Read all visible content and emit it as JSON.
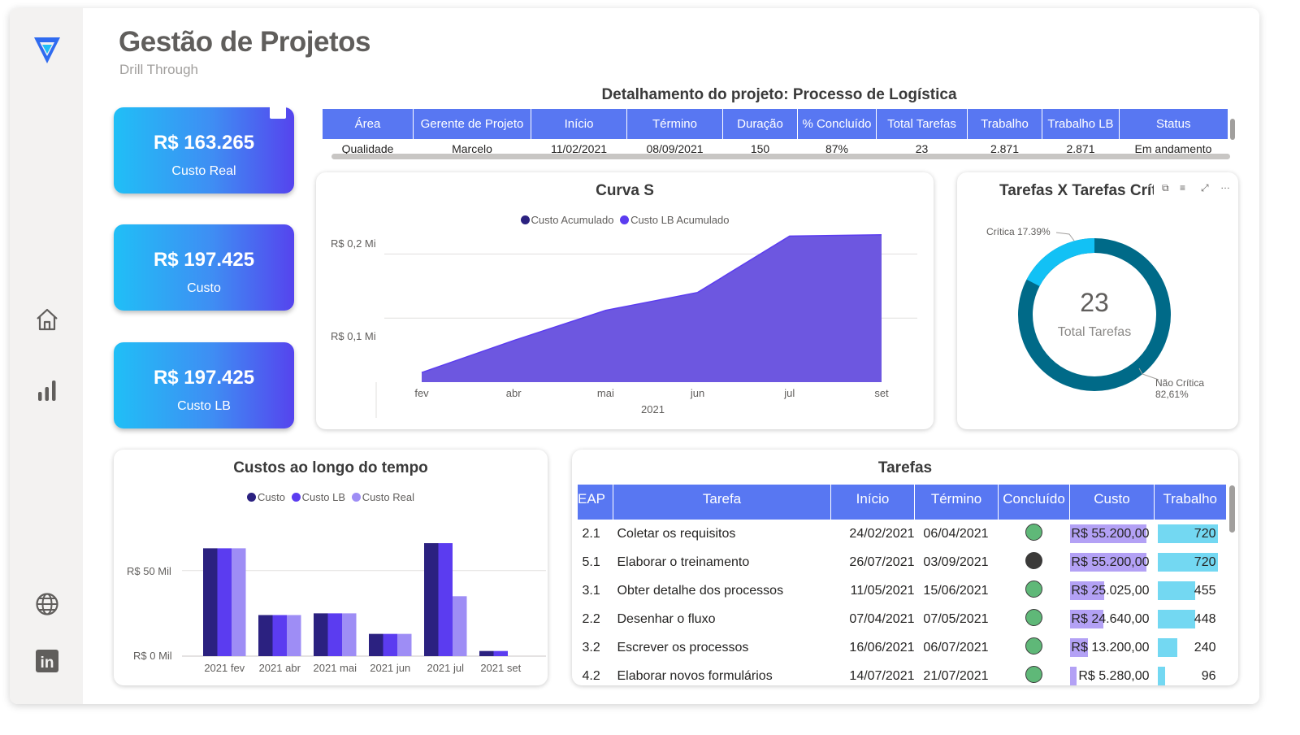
{
  "page": {
    "title": "Gestão de Projetos",
    "subtitle": "Drill Through"
  },
  "sidebar": {
    "items": [
      {
        "icon": "logo-icon"
      },
      {
        "icon": "home-icon"
      },
      {
        "icon": "bar-chart-icon"
      },
      {
        "icon": "globe-icon"
      },
      {
        "icon": "linkedin-icon",
        "text": "in"
      }
    ]
  },
  "kpis": [
    {
      "value": "R$ 163.265",
      "label": "Custo Real"
    },
    {
      "value": "R$ 197.425",
      "label": "Custo"
    },
    {
      "value": "R$ 197.425",
      "label": "Custo LB"
    }
  ],
  "detail": {
    "title": "Detalhamento do projeto: Processo de Logística",
    "columns": [
      "Área",
      "Gerente de Projeto",
      "Início",
      "Término",
      "Duração",
      "% Concluído",
      "Total Tarefas",
      "Trabalho",
      "Trabalho LB",
      "Status"
    ],
    "row": [
      "Qualidade",
      "Marcelo",
      "11/02/2021",
      "08/09/2021",
      "150",
      "87%",
      "23",
      "2.871",
      "2.871",
      "Em andamento"
    ]
  },
  "curva_s": {
    "title": "Curva S",
    "legend": [
      {
        "name": "Custo Acumulado",
        "color": "#2b2180"
      },
      {
        "name": "Custo LB Acumulado",
        "color": "#5b3cf0"
      }
    ],
    "y_ticks": [
      "R$ 0,2 Mi",
      "R$ 0,1 Mi"
    ],
    "x_ticks": [
      "fev",
      "abr",
      "mai",
      "jun",
      "jul",
      "set"
    ],
    "x_title": "2021"
  },
  "donut": {
    "title": "Tarefas X Tarefas Críticas",
    "center_value": "23",
    "center_label": "Total Tarefas",
    "label_critica": "Crítica 17.39%",
    "label_nao_critica_1": "Não Crítica",
    "label_nao_critica_2": "82,61%"
  },
  "custos": {
    "title": "Custos ao longo do tempo",
    "legend": [
      {
        "name": "Custo",
        "color": "#2b2180"
      },
      {
        "name": "Custo LB",
        "color": "#5b3cf0"
      },
      {
        "name": "Custo Real",
        "color": "#9e8df5"
      }
    ],
    "y_ticks": [
      "R$ 50 Mil",
      "R$ 0 Mil"
    ]
  },
  "tarefas": {
    "title": "Tarefas",
    "columns": [
      "EAP",
      "Tarefa",
      "Início",
      "Término",
      "Concluído",
      "Custo",
      "Trabalho"
    ],
    "rows": [
      {
        "eap": "2.1",
        "tarefa": "Coletar os requisitos",
        "inicio": "24/02/2021",
        "termino": "06/04/2021",
        "status_color": "#5fb878",
        "custo": "R$ 55.200,00",
        "custo_value": 55200,
        "trabalho": "720",
        "trabalho_value": 720
      },
      {
        "eap": "5.1",
        "tarefa": "Elaborar o treinamento",
        "inicio": "26/07/2021",
        "termino": "03/09/2021",
        "status_color": "#3b3a39",
        "custo": "R$ 55.200,00",
        "custo_value": 55200,
        "trabalho": "720",
        "trabalho_value": 720
      },
      {
        "eap": "3.1",
        "tarefa": "Obter detalhe dos processos",
        "inicio": "11/05/2021",
        "termino": "15/06/2021",
        "status_color": "#5fb878",
        "custo": "R$ 25.025,00",
        "custo_value": 25025,
        "trabalho": "455",
        "trabalho_value": 455
      },
      {
        "eap": "2.2",
        "tarefa": "Desenhar o fluxo",
        "inicio": "07/04/2021",
        "termino": "07/05/2021",
        "status_color": "#5fb878",
        "custo": "R$ 24.640,00",
        "custo_value": 24640,
        "trabalho": "448",
        "trabalho_value": 448
      },
      {
        "eap": "3.2",
        "tarefa": "Escrever os processos",
        "inicio": "16/06/2021",
        "termino": "06/07/2021",
        "status_color": "#5fb878",
        "custo": "R$ 13.200,00",
        "custo_value": 13200,
        "trabalho": "240",
        "trabalho_value": 240
      },
      {
        "eap": "4.2",
        "tarefa": "Elaborar novos formulários",
        "inicio": "14/07/2021",
        "termino": "21/07/2021",
        "status_color": "#5fb878",
        "custo": "R$ 5.280,00",
        "custo_value": 5280,
        "trabalho": "96",
        "trabalho_value": 96
      }
    ]
  },
  "colors": {
    "header_blue": "#5877f2",
    "custo_bar": "#b3a1f5",
    "trabalho_bar": "#73d8f2",
    "donut_dark": "#006a88",
    "donut_light": "#12c1f5",
    "area_fill": "#6d57e0"
  },
  "chart_data": [
    {
      "type": "area",
      "title": "Curva S",
      "x": [
        "fev",
        "abr",
        "mai",
        "jun",
        "jul",
        "set"
      ],
      "xlabel": "2021",
      "series": [
        {
          "name": "Custo Acumulado",
          "values": [
            0.015,
            0.065,
            0.112,
            0.14,
            0.228,
            0.23
          ]
        },
        {
          "name": "Custo LB Acumulado",
          "values": [
            0.015,
            0.065,
            0.112,
            0.14,
            0.228,
            0.23
          ]
        }
      ],
      "y_ticks": [
        0.1,
        0.2
      ],
      "ylim": [
        0,
        0.25
      ],
      "y_unit": "R$ Mi",
      "grid": true,
      "legend": "top"
    },
    {
      "type": "pie",
      "title": "Tarefas X Tarefas Críticas",
      "labels": [
        "Crítica",
        "Não Crítica"
      ],
      "values": [
        17.39,
        82.61
      ]
    },
    {
      "type": "bar",
      "title": "Custos ao longo do tempo",
      "categories": [
        "2021 fev",
        "2021 abr",
        "2021 mai",
        "2021 jun",
        "2021 jul",
        "2021 set"
      ],
      "series": [
        {
          "name": "Custo",
          "values": [
            63,
            24,
            25,
            13,
            66,
            3
          ]
        },
        {
          "name": "Custo LB",
          "values": [
            63,
            24,
            25,
            13,
            66,
            3
          ]
        },
        {
          "name": "Custo Real",
          "values": [
            63,
            24,
            25,
            13,
            35,
            0
          ]
        }
      ],
      "y_unit": "R$ Mil",
      "y_ticks": [
        0,
        50
      ],
      "ylim": [
        0,
        70
      ],
      "legend": "top"
    }
  ]
}
